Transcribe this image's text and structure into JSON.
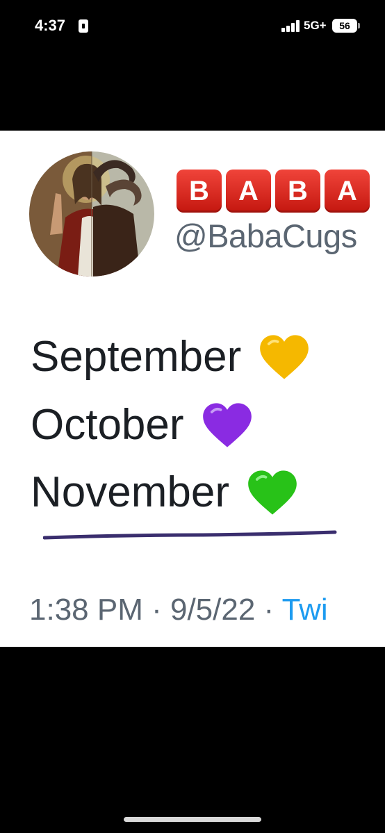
{
  "status_bar": {
    "time": "4:37",
    "network": "5G+",
    "battery": "56"
  },
  "tweet": {
    "name_letters": [
      "B",
      "A",
      "B",
      "A"
    ],
    "handle": "@BabaCugs",
    "lines": [
      {
        "text": "September",
        "heart": "yellow-heart-icon",
        "heart_color": "#f5b800"
      },
      {
        "text": "October",
        "heart": "purple-heart-icon",
        "heart_color": "#8a2be2"
      },
      {
        "text": "November",
        "heart": "green-heart-icon",
        "heart_color": "#28c218"
      }
    ],
    "underline_color": "#3a2e6e",
    "meta": {
      "time": "1:38 PM",
      "sep1": " · ",
      "date": "9/5/22",
      "sep2": " · ",
      "source": "Twi"
    },
    "link_color": "#1d9bf0"
  }
}
